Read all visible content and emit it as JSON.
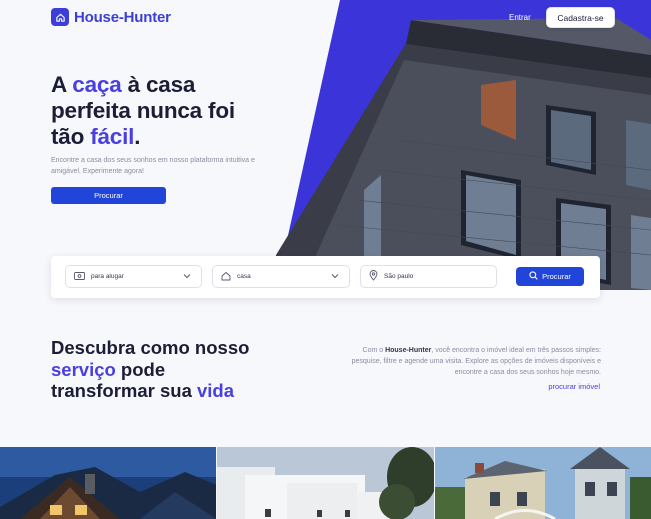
{
  "header": {
    "logo_text": "House-Hunter",
    "login_label": "Entrar",
    "signup_label": "Cadastra-se"
  },
  "hero": {
    "title_part1": "A ",
    "title_accent1": "caça",
    "title_part2": " à casa perfeita nunca foi tão ",
    "title_accent2": "fácil",
    "title_part3": ".",
    "subtitle": "Encontre a casa dos seus sonhos em nosso plataforma intuitiva e amigável. Experimente agora!",
    "cta_label": "Procurar"
  },
  "search": {
    "purpose_value": "para alugar",
    "type_value": "casa",
    "location_value": "São paulo",
    "button_label": "Procurar"
  },
  "discover": {
    "title_part1": "Descubra como nosso ",
    "title_accent1": "serviço",
    "title_part2": " pode transformar sua ",
    "title_accent2": "vida",
    "text_part1": "Com o ",
    "text_brand": "House-Hunter",
    "text_part2": ", você encontra o imóvel ideal em três passos simples: pesquise, filtre e agende uma visita. Explore as opções de imóveis disponíveis e encontre a casa dos seus sonhos hoje mesmo.",
    "link_label": "procurar imóvel"
  },
  "colors": {
    "accent": "#4a3fe0",
    "button_blue": "#2145d8",
    "hero_bg": "#3b35d9"
  }
}
